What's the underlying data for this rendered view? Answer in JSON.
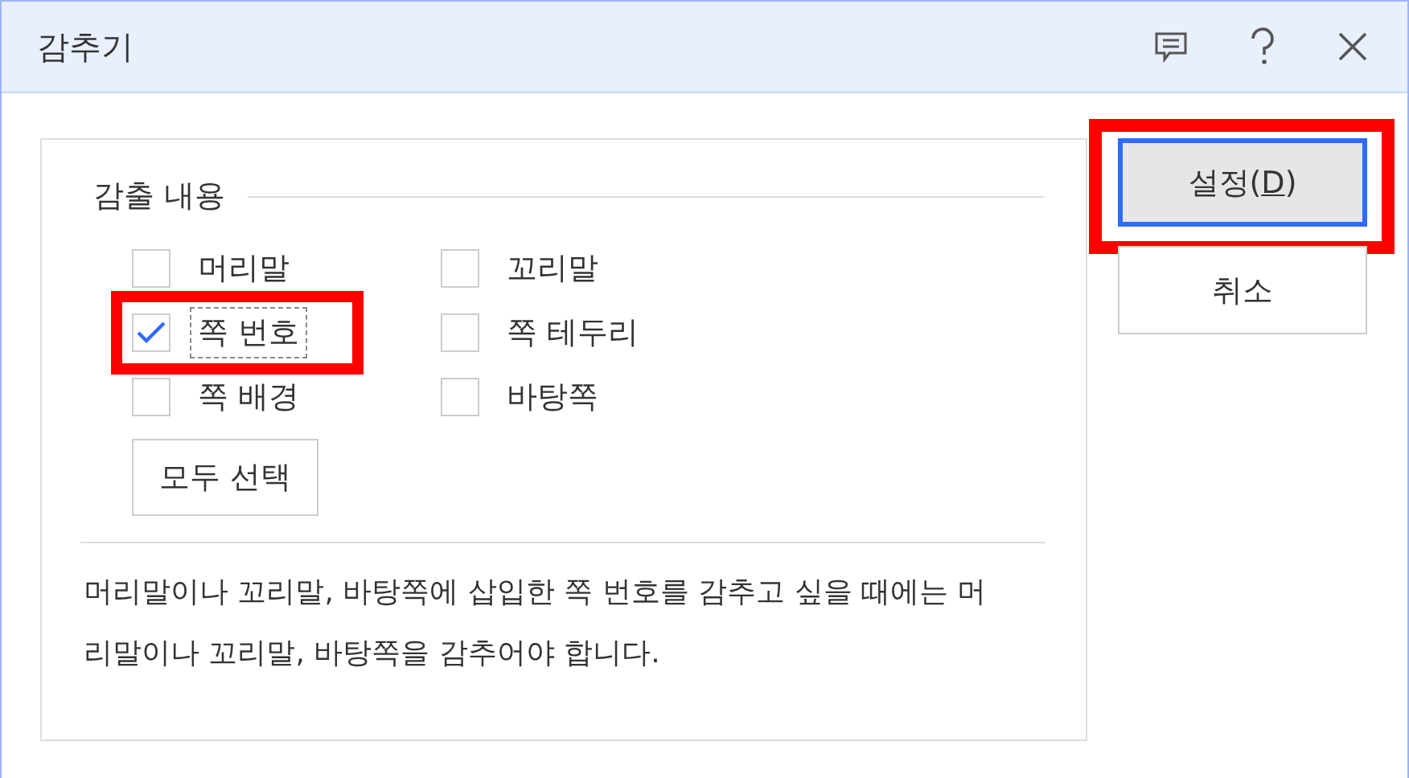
{
  "window": {
    "title": "감추기",
    "buttons": [
      {
        "kind": "comment"
      },
      {
        "kind": "help"
      },
      {
        "kind": "close"
      }
    ]
  },
  "group": {
    "title": "감출 내용",
    "options": [
      {
        "label": "머리말",
        "checked": false,
        "focused": false,
        "highlighted": false
      },
      {
        "label": "꼬리말",
        "checked": false,
        "focused": false,
        "highlighted": false
      },
      {
        "label": "쪽 번호",
        "checked": true,
        "focused": true,
        "highlighted": true
      },
      {
        "label": "쪽 테두리",
        "checked": false,
        "focused": false,
        "highlighted": false
      },
      {
        "label": "쪽 배경",
        "checked": false,
        "focused": false,
        "highlighted": false
      },
      {
        "label": "바탕쪽",
        "checked": false,
        "focused": false,
        "highlighted": false
      }
    ],
    "select_all": "모두 선택",
    "note": "머리말이나 꼬리말, 바탕쪽에 삽입한 쪽 번호를 감추고 싶을 때에는 머리말이나 꼬리말, 바탕쪽을 감추어야 합니다."
  },
  "actions": [
    {
      "before": "설정(",
      "mnemonic": "D",
      "after": ")",
      "default": true,
      "highlighted": true
    },
    {
      "before": "취소",
      "default": false,
      "highlighted": false
    }
  ]
}
